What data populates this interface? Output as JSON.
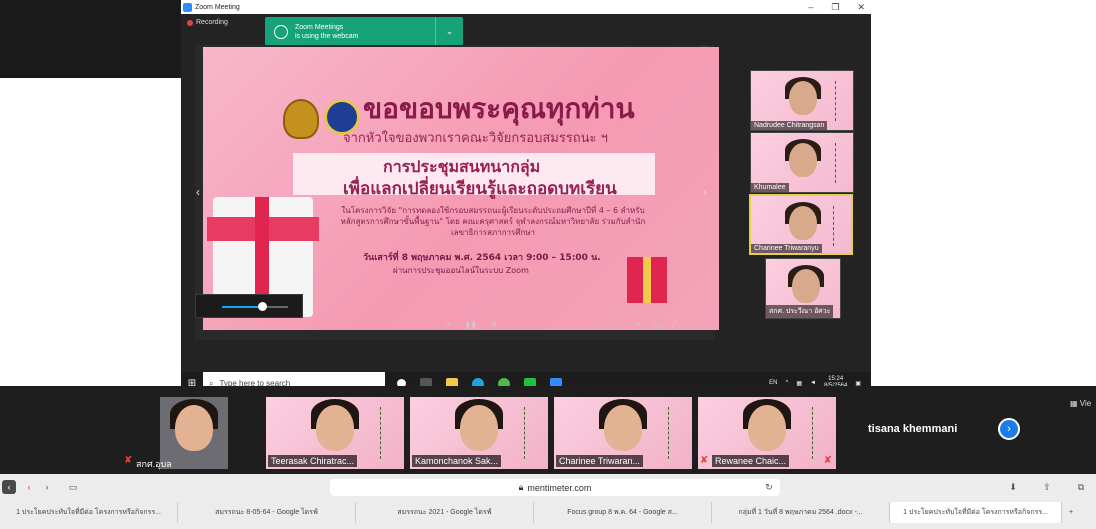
{
  "zoom_window": {
    "title": "Zoom Meeting",
    "recording": "Recording",
    "toast_line1": "Zoom Meetings",
    "toast_line2": "is using the webcam"
  },
  "slide": {
    "title": "ขอขอบพระคุณทุกท่าน",
    "subtitle": "จากหัวใจของพวกเราคณะวิจัยกรอบสมรรถนะ ฯ",
    "box_line1": "การประชุมสนทนากลุ่ม",
    "box_line2": "เพื่อแลกเปลี่ยนเรียนรู้และถอดบทเรียน",
    "desc": "ในโครงการวิจัย \"การทดลองใช้กรอบสมรรถนะผู้เรียนระดับประถมศึกษาปีที่ 4 – 6 สำหรับหลักสูตรการศึกษาขั้นพื้นฐาน\" โดย คณะครุศาสตร์ จุฬาลงกรณ์มหาวิทยาลัย ร่วมกับสำนักเลขาธิการสภาการศึกษา",
    "date": "วันเสาร์ที่ 8 พฤษภาคม พ.ศ. 2564 เวลา 9:00 – 15:00 น.",
    "venue": "ผ่านการประชุมออนไลน์ในระบบ Zoom"
  },
  "gallery": [
    {
      "name": "Nadrudee Chitrangsan",
      "active": false
    },
    {
      "name": "Khumalee",
      "active": false
    },
    {
      "name": "Charinee Triwaranyu",
      "active": true
    },
    {
      "name": "สกศ. ประวีณา อัศวะ",
      "active": false
    }
  ],
  "taskbar": {
    "search_placeholder": "Type here to search",
    "lang": "EN",
    "time": "15:24",
    "date": "8/5/2564"
  },
  "participants": [
    {
      "name": "สกศ.อุบล",
      "muted": true
    },
    {
      "name": "Teerasak Chiratrac...",
      "muted": false
    },
    {
      "name": "Kamonchanok Sak...",
      "muted": false
    },
    {
      "name": "Charinee Triwaran...",
      "muted": false
    },
    {
      "name": "Rewanee Chaic...",
      "muted": true
    }
  ],
  "participant_strip": {
    "speaker_name": "tisana khemmani",
    "view_label": "Vie"
  },
  "browser": {
    "address": "mentimeter.com",
    "tabs": [
      {
        "label": "1 ประโยคประทับใจที่มีต่อ โครงการหรือกิจกรร...",
        "active": false
      },
      {
        "label": "สมรรถนะ 8-05-64 - Google ไดรฟ์",
        "active": false
      },
      {
        "label": "สมรรถนะ 2021 - Google ไดรฟ์",
        "active": false
      },
      {
        "label": "Focus group 8 พ.ค. 64 - Google ส...",
        "active": false
      },
      {
        "label": "กลุ่มที่ 1 วันที่ 8 พฤษภาคม 2564 .docx -...",
        "active": false
      },
      {
        "label": "1 ประโยคประทับใจที่มีต่อ โครงการหรือกิจกรร...",
        "active": true
      }
    ]
  },
  "colors": {
    "zoom_blue": "#2d8cff",
    "toast_green": "#16a37a",
    "slide_pink": "#f59ab3",
    "active_border": "#e6cf4a"
  }
}
